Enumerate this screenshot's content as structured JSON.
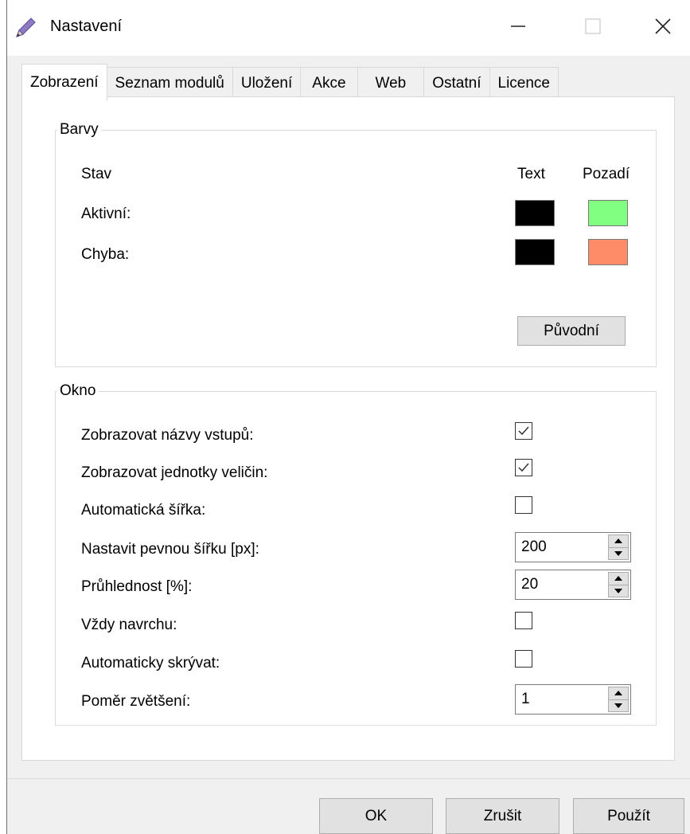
{
  "window": {
    "title": "Nastavení",
    "icon": "pencil-icon",
    "controls": {
      "minimize": "minimize-icon",
      "maximize": "maximize-icon",
      "close": "close-icon"
    }
  },
  "tabs": [
    {
      "label": "Zobrazení",
      "active": true
    },
    {
      "label": "Seznam modulů",
      "active": false
    },
    {
      "label": "Uložení",
      "active": false
    },
    {
      "label": "Akce",
      "active": false
    },
    {
      "label": "Web",
      "active": false
    },
    {
      "label": "Ostatní",
      "active": false
    },
    {
      "label": "Licence",
      "active": false
    }
  ],
  "colors_group": {
    "legend": "Barvy",
    "header_state": "Stav",
    "header_text": "Text",
    "header_background": "Pozadí",
    "rows": [
      {
        "label": "Aktivní:",
        "text_color": "#000000",
        "background_color": "#80ff80"
      },
      {
        "label": "Chyba:",
        "text_color": "#000000",
        "background_color": "#ff8c69"
      }
    ],
    "reset_button": "Původní"
  },
  "window_group": {
    "legend": "Okno",
    "show_input_names": {
      "label": "Zobrazovat názvy vstupů:",
      "checked": true
    },
    "show_units": {
      "label": "Zobrazovat jednotky veličin:",
      "checked": true
    },
    "auto_width": {
      "label": "Automatická šířka:",
      "checked": false
    },
    "fixed_width": {
      "label": "Nastavit pevnou šířku [px]:",
      "value": "200"
    },
    "transparency": {
      "label": "Průhlednost [%]:",
      "value": "20"
    },
    "always_on_top": {
      "label": "Vždy navrchu:",
      "checked": false
    },
    "auto_hide": {
      "label": "Automaticky skrývat:",
      "checked": false
    },
    "zoom_ratio": {
      "label": "Poměr zvětšení:",
      "value": "1"
    }
  },
  "footer": {
    "ok": "OK",
    "cancel": "Zrušit",
    "apply": "Použít"
  }
}
